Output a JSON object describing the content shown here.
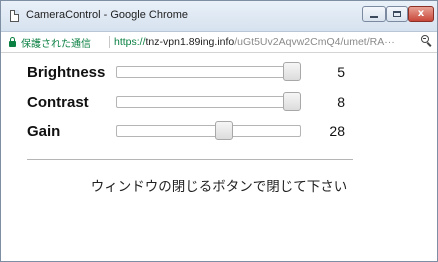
{
  "window": {
    "title": "CameraControl - Google Chrome",
    "minimize_icon": "minimize-icon",
    "maximize_icon": "maximize-icon",
    "close_icon": "close-icon",
    "close_glyph": "x",
    "close_color": "#c8473a"
  },
  "address_bar": {
    "secure_icon": "lock-icon",
    "secure_label": "保護された通信",
    "url_scheme": "https://",
    "url_host": "tnz-vpn1.89ing.info",
    "url_path": "/uGt5Uv2Aqvw2CmQ4/umet/RA···",
    "zoom_icon": "zoom-out-icon",
    "secure_color": "#0b8043"
  },
  "controls": [
    {
      "label": "Brightness",
      "value": "5",
      "slider_position": 1.0
    },
    {
      "label": "Contrast",
      "value": "8",
      "slider_position": 1.0
    },
    {
      "label": "Gain",
      "value": "28",
      "slider_position": 0.59
    }
  ],
  "message": "ウィンドウの閉じるボタンで閉じて下さい"
}
